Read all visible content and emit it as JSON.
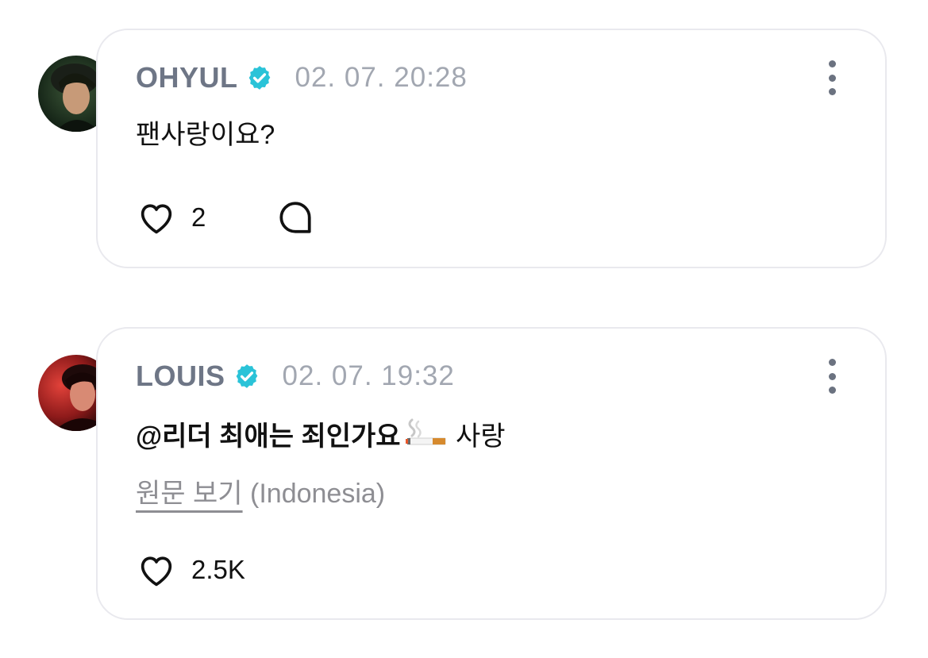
{
  "comments": [
    {
      "author": "OHYUL",
      "verified": true,
      "timestamp": "02. 07. 20:28",
      "text": "팬사랑이요?",
      "likes": "2",
      "avatar_icon": "profile-photo-dark-green",
      "has_reply_button": true
    },
    {
      "author": "LOUIS",
      "verified": true,
      "timestamp": "02. 07. 19:32",
      "mention": "@리더 최애는 죄인가요",
      "emoji": "cigarette-emoji",
      "text_after": "사랑",
      "view_original_label": "원문 보기",
      "original_language": "(Indonesia)",
      "likes": "2.5K",
      "avatar_icon": "profile-photo-red"
    }
  ],
  "colors": {
    "author_name": "#6e7686",
    "timestamp": "#a2a7b1",
    "verified_badge": "#2ac3d8",
    "card_border": "#e9e9ee",
    "secondary_text": "#8e8e93"
  }
}
